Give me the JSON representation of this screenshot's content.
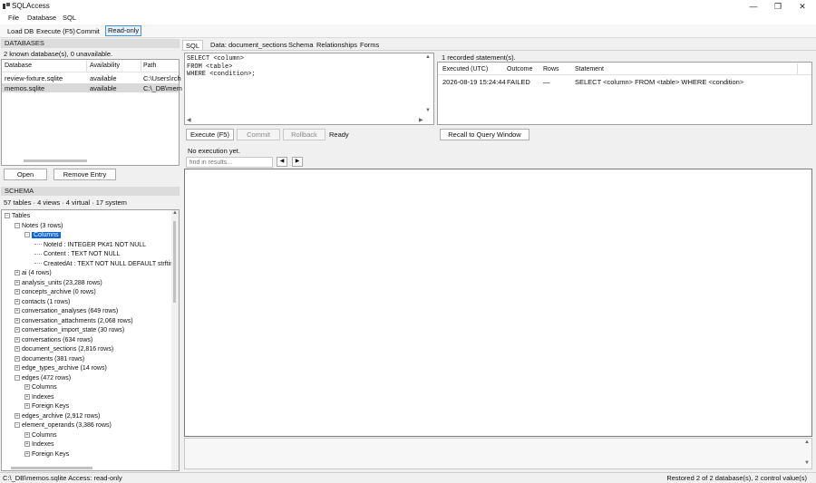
{
  "window": {
    "title": "SQLAccess"
  },
  "menu": [
    "File",
    "Database",
    "SQL"
  ],
  "toolbar": {
    "load_db": "Load DB",
    "execute": "Execute (F5)",
    "commit": "Commit",
    "read_only": "Read-only"
  },
  "databases": {
    "header": "DATABASES",
    "summary": "2 known database(s), 0 unavailable.",
    "columns": [
      "Database",
      "Availability",
      "Path"
    ],
    "rows": [
      [
        "review-fixture.sqlite",
        "available",
        "C:\\Users\\rch"
      ],
      [
        "memos.sqlite",
        "available",
        "C:\\_DB\\mem"
      ]
    ],
    "open_btn": "Open",
    "remove_btn": "Remove Entry"
  },
  "schema": {
    "header": "SCHEMA",
    "summary": "57 tables · 4 views · 4 virtual · 17 system",
    "tree": [
      {
        "label": "Tables",
        "level": 0,
        "exp": "-"
      },
      {
        "label": "Notes (3 rows)",
        "level": 1,
        "exp": "-"
      },
      {
        "label": "Columns",
        "level": 2,
        "exp": "-",
        "selected": true
      },
      {
        "label": "NoteId : INTEGER PK#1 NOT NULL",
        "level": 3,
        "exp": ""
      },
      {
        "label": "Content : TEXT NOT NULL",
        "level": 3,
        "exp": ""
      },
      {
        "label": "CreatedAt : TEXT NOT NULL DEFAULT strftim",
        "level": 3,
        "exp": ""
      },
      {
        "label": "ai (4 rows)",
        "level": 1,
        "exp": "+"
      },
      {
        "label": "analysis_units (23,288 rows)",
        "level": 1,
        "exp": "+"
      },
      {
        "label": "concepts_archive (0 rows)",
        "level": 1,
        "exp": "+"
      },
      {
        "label": "contacts (1 rows)",
        "level": 1,
        "exp": "+"
      },
      {
        "label": "conversation_analyses (649 rows)",
        "level": 1,
        "exp": "+"
      },
      {
        "label": "conversation_attachments (2,068 rows)",
        "level": 1,
        "exp": "+"
      },
      {
        "label": "conversation_import_state (30 rows)",
        "level": 1,
        "exp": "+"
      },
      {
        "label": "conversations (634 rows)",
        "level": 1,
        "exp": "+"
      },
      {
        "label": "document_sections (2,816 rows)",
        "level": 1,
        "exp": "+"
      },
      {
        "label": "documents (381 rows)",
        "level": 1,
        "exp": "+"
      },
      {
        "label": "edge_types_archive (14 rows)",
        "level": 1,
        "exp": "+"
      },
      {
        "label": "edges (472 rows)",
        "level": 1,
        "exp": "-"
      },
      {
        "label": "Columns",
        "level": 2,
        "exp": "+"
      },
      {
        "label": "Indexes",
        "level": 2,
        "exp": "+"
      },
      {
        "label": "Foreign Keys",
        "level": 2,
        "exp": "+"
      },
      {
        "label": "edges_archive (2,912 rows)",
        "level": 1,
        "exp": "+"
      },
      {
        "label": "element_operands (3,386 rows)",
        "level": 1,
        "exp": "-"
      },
      {
        "label": "Columns",
        "level": 2,
        "exp": "+"
      },
      {
        "label": "Indexes",
        "level": 2,
        "exp": "+"
      },
      {
        "label": "Foreign Keys",
        "level": 2,
        "exp": "+"
      }
    ]
  },
  "tabs": [
    "SQL",
    "Data: document_sections",
    "Schema",
    "Relationships",
    "Forms"
  ],
  "editor": {
    "lines": [
      "SELECT <column>",
      "FROM <table>",
      "WHERE <condition>;"
    ]
  },
  "history": {
    "summary": "1 recorded statement(s).",
    "columns": [
      "Executed (UTC)",
      "Outcome",
      "Rows",
      "Statement"
    ],
    "rows": [
      [
        "2026-08-19 15:24:44",
        "FAILED",
        "—",
        "SELECT <column> FROM <table> WHERE <condition>"
      ]
    ],
    "recall_btn": "Recall to Query Window"
  },
  "exec_bar": {
    "execute": "Execute (F5)",
    "commit": "Commit",
    "rollback": "Rollback",
    "state": "Ready"
  },
  "results": {
    "message": "No execution yet.",
    "find_placeholder": "find in results..."
  },
  "status": {
    "left": "C:\\_DB\\memos.sqlite  Access: read-only",
    "right": "Restored 2 of 2 database(s), 2 control value(s)"
  }
}
